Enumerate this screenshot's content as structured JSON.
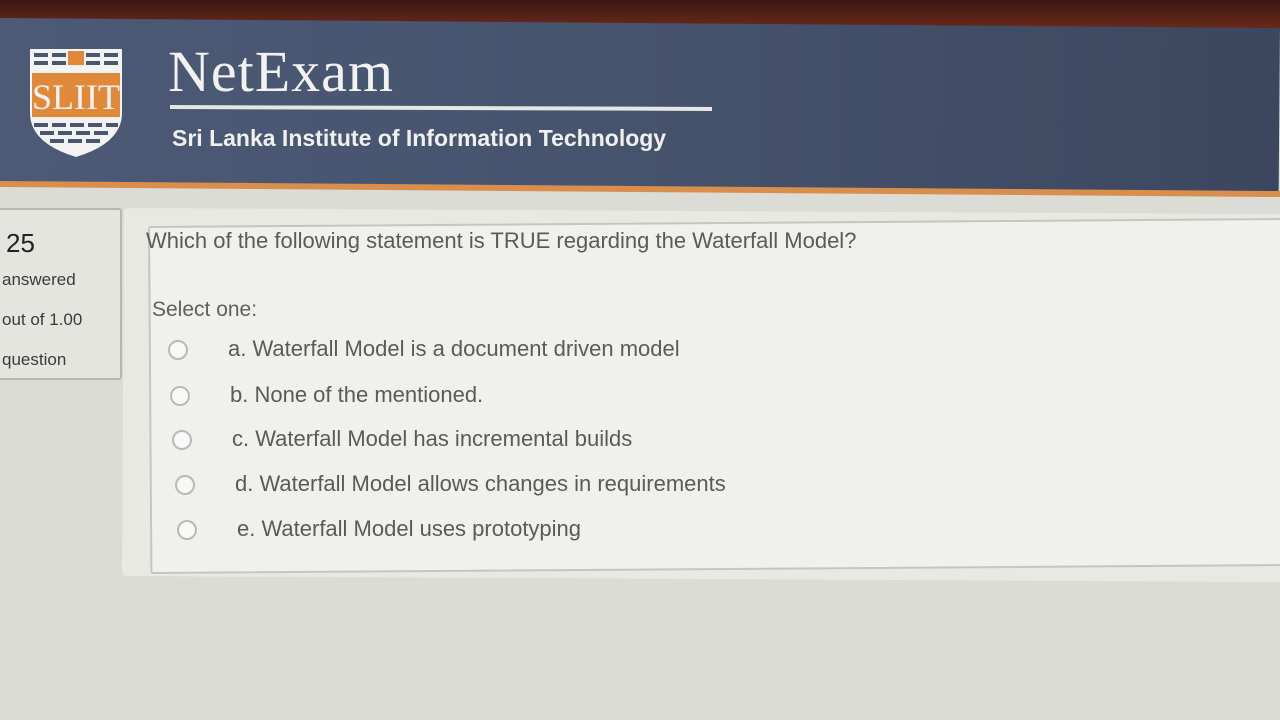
{
  "header": {
    "logo_text": "SLIIT",
    "title": "NetExam",
    "subtitle": "Sri Lanka Institute of Information Technology"
  },
  "question_info": {
    "number": "25",
    "status": "answered",
    "marks": "out of 1.00",
    "flag": "question"
  },
  "question": {
    "text": "Which of the following statement is TRUE regarding the Waterfall Model?",
    "prompt": "Select one:",
    "options": [
      {
        "label": "a. Waterfall Model is a document driven model",
        "selected": false
      },
      {
        "label": "b. None of the mentioned.",
        "selected": false
      },
      {
        "label": "c. Waterfall Model has incremental builds",
        "selected": false
      },
      {
        "label": "d. Waterfall Model allows changes in requirements",
        "selected": false
      },
      {
        "label": "e. Waterfall Model uses prototyping",
        "selected": false
      }
    ]
  },
  "colors": {
    "header_bg": "#46536d",
    "header_accent": "#d98e4e",
    "logo_orange": "#e0893a",
    "page_bg": "#dcdcd6"
  }
}
